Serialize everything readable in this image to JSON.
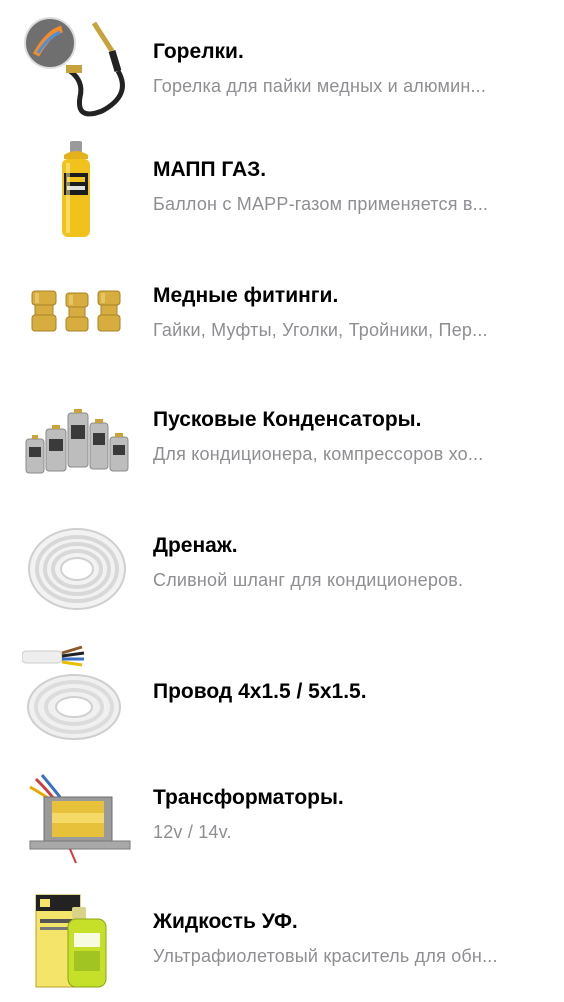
{
  "products": [
    {
      "title": "Горелки.",
      "subtitle": "Горелка  для пайки медных и алюмин...",
      "icon": "torch-icon"
    },
    {
      "title": "МАПП ГАЗ.",
      "subtitle": "Баллон с MAPP-газом применяется в...",
      "icon": "gas-cylinder-icon"
    },
    {
      "title": "Медные фитинги.",
      "subtitle": "Гайки, Муфты, Уголки, Тройники,  Пер...",
      "icon": "brass-fittings-icon"
    },
    {
      "title": "Пусковые Конденсаторы.",
      "subtitle": "Для кондиционера, компрессоров хо...",
      "icon": "capacitors-icon"
    },
    {
      "title": "Дренаж.",
      "subtitle": "Сливной шланг для кондиционеров.",
      "icon": "drain-hose-icon"
    },
    {
      "title": "Провод 4x1.5 / 5x1.5.",
      "subtitle": "",
      "icon": "cable-coil-icon"
    },
    {
      "title": "Трансформаторы.",
      "subtitle": "12v / 14v.",
      "icon": "transformer-icon"
    },
    {
      "title": "Жидкость УФ.",
      "subtitle": "Ультрафиолетовый краситель для обн...",
      "icon": "uv-dye-bottle-icon"
    }
  ]
}
